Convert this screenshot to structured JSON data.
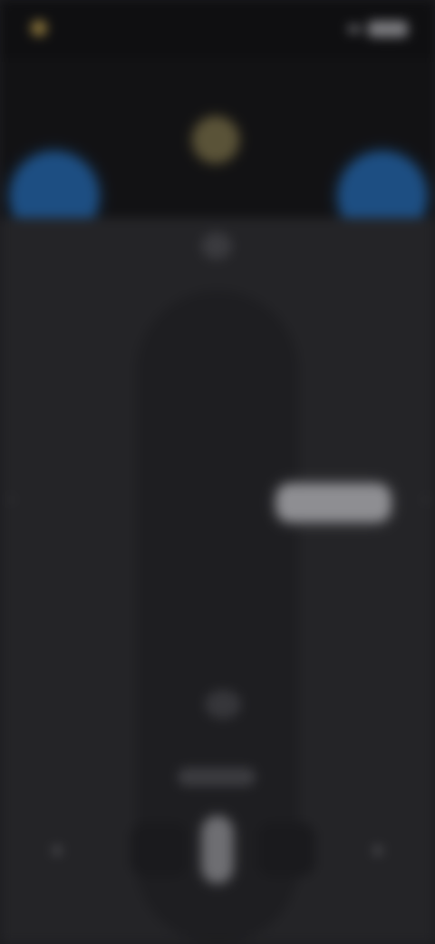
{
  "status_bar": {
    "carrier": "",
    "clock": ""
  },
  "header": {
    "left_participant_name": "",
    "right_participant_name": ""
  },
  "main": {
    "value_label": "",
    "caption": ""
  },
  "icons": {
    "status": "carrier-icon",
    "signal": "signal-icon",
    "battery": "battery-icon",
    "badge": "center-badge-icon",
    "left_arrow": "chevron-left-icon",
    "right_arrow": "chevron-right-icon",
    "ctrl_left": "star-icon",
    "ctrl_right": "star-icon",
    "mic": "microphone-icon"
  },
  "colors": {
    "avatar": "#1d4e82",
    "badge": "#5a5338",
    "background": "#232326"
  }
}
